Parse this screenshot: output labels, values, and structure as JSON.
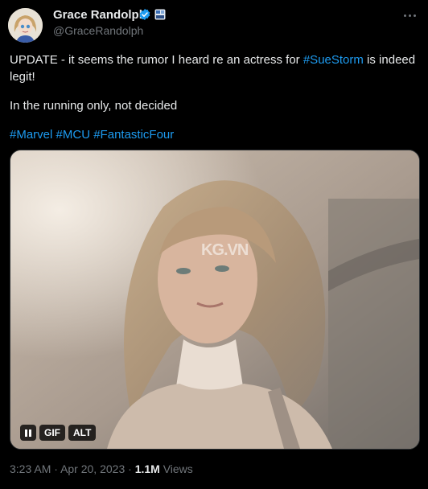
{
  "author": {
    "name": "Grace Randolph",
    "handle": "@GraceRandolph",
    "verified": true,
    "icons": [
      "verified-badge-icon",
      "affiliate-badge-icon"
    ]
  },
  "tweet": {
    "paragraph1_plain": "UPDATE - it seems the rumor I heard re an actress for ",
    "paragraph1_hashtag": "#SueStorm",
    "paragraph1_tail": " is indeed legit!",
    "paragraph2": "In the running only, not decided",
    "hashtags": [
      "#Marvel",
      "#MCU",
      "#FantasticFour"
    ]
  },
  "media": {
    "type": "gif",
    "controls": {
      "pause_icon": "pause-icon",
      "gif_label": "GIF",
      "alt_label": "ALT"
    },
    "watermark": "KG.VN"
  },
  "meta": {
    "time": "3:23 AM",
    "separator": "·",
    "date": "Apr 20, 2023",
    "views_count": "1.1M",
    "views_label": "Views"
  },
  "colors": {
    "background": "#000000",
    "text": "#e7e9ea",
    "secondary": "#71767b",
    "link": "#1d9bf0",
    "verified": "#1d9bf0"
  }
}
